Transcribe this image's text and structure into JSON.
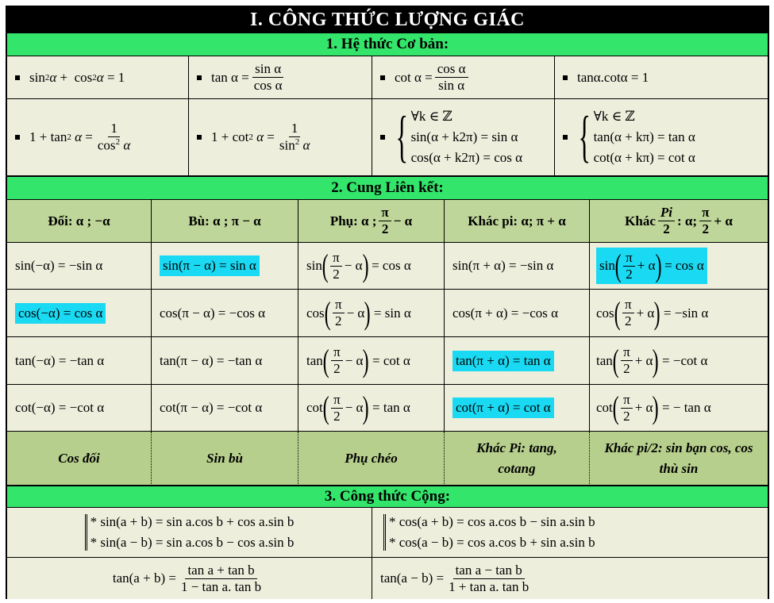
{
  "title": "I.  CÔNG THỨC LƯỢNG GIÁC",
  "section1": {
    "title": "1.  Hệ thức Cơ bản:",
    "r1": [
      "sin²α +  cos²α = 1",
      "tan α = sin α / cos α",
      "cot α = cos α / sin α",
      "tanα.cotα =  1"
    ],
    "sin2": "sin",
    "cos2": "cos",
    "plus": "+",
    "eq1": "= 1",
    "tan_lbl": "tan α =",
    "sin_a": "sin α",
    "cos_a": "cos α",
    "cot_lbl": "cot α =",
    "tancot": "tanα.cotα =  1",
    "r2_1_lhs": "1 + tan",
    "r2_1_rhs_n": "1",
    "r2_1_rhs_d": "cos",
    "r2_2_lhs": "1 + cot",
    "r2_2_rhs_n": "1",
    "r2_2_rhs_d": "sin",
    "period1": [
      "∀k ∈ ℤ",
      "sin(α + k2π) = sin α",
      "cos(α + k2π) = cos α"
    ],
    "period2": [
      "∀k ∈ ℤ",
      "tan(α + kπ) = tan α",
      "cot(α + kπ) = cot α"
    ]
  },
  "section2": {
    "title": "2.  Cung Liên kết:",
    "headers": {
      "h1": "Đối:  α ; −α",
      "h2": "Bù:  α ;  π − α",
      "h3a": "Phụ:  α ; ",
      "h3b": "− α",
      "h4": "Khác pi:  α; π + α",
      "h5a": "Khác ",
      "h5b": " : α; ",
      "h5c": " + α",
      "pi": "π",
      "two": "2",
      "Pi": "Pi"
    },
    "col1": [
      "sin(−α) = −sin α",
      "cos(−α) = cos α",
      "tan(−α) = −tan α",
      "cot(−α) = −cot α"
    ],
    "col2": [
      "sin(π − α) = sin α",
      "cos(π − α) = −cos α",
      "tan(π − α) = −tan α",
      "cot(π − α) = −cot α"
    ],
    "col3_fn": [
      "sin",
      "cos",
      "tan",
      "cot"
    ],
    "col3_op": "− α",
    "col3_rhs": [
      "=  cos α",
      "=  sin α",
      "=  cot α",
      "=  tan α"
    ],
    "col4": [
      "sin(π + α) = −sin α",
      "cos(π + α) = −cos α",
      "tan(π + α) = tan α",
      "cot(π + α) = cot α"
    ],
    "col5_fn": [
      "sin",
      "cos",
      "tan",
      "cot"
    ],
    "col5_op": "+ α",
    "col5_rhs": [
      "= cos α",
      "= −sin α",
      "= −cot α",
      "= − tan α"
    ],
    "notes": [
      "Cos đối",
      "Sin bù",
      "Phụ chéo",
      "Khác Pi: tang, cotang",
      "Khác pi/2: sin bạn cos, cos thù sin"
    ]
  },
  "section3": {
    "title": "3.  Công thức Cộng:",
    "left": [
      "* sin(a + b) = sin a.cos b + cos a.sin b",
      "* sin(a − b) = sin a.cos b − cos a.sin b"
    ],
    "right": [
      "* cos(a + b) = cos a.cos b − sin a.sin b",
      "* cos(a − b) = cos a.cos b + sin a.sin b"
    ],
    "tan_plus_lhs": "tan(a + b) =",
    "tan_plus_n": "tan a + tan b",
    "tan_plus_d": "1 − tan a. tan b",
    "tan_minus_lhs": "tan(a − b) =",
    "tan_minus_n": "tan a − tan b",
    "tan_minus_d": "1 + tan a. tan b"
  },
  "colors": {
    "green_bar": "#33e66b",
    "header_bg": "#bfd69a",
    "cell_bg": "#eeeedd",
    "highlight": "#1ad9f2"
  }
}
